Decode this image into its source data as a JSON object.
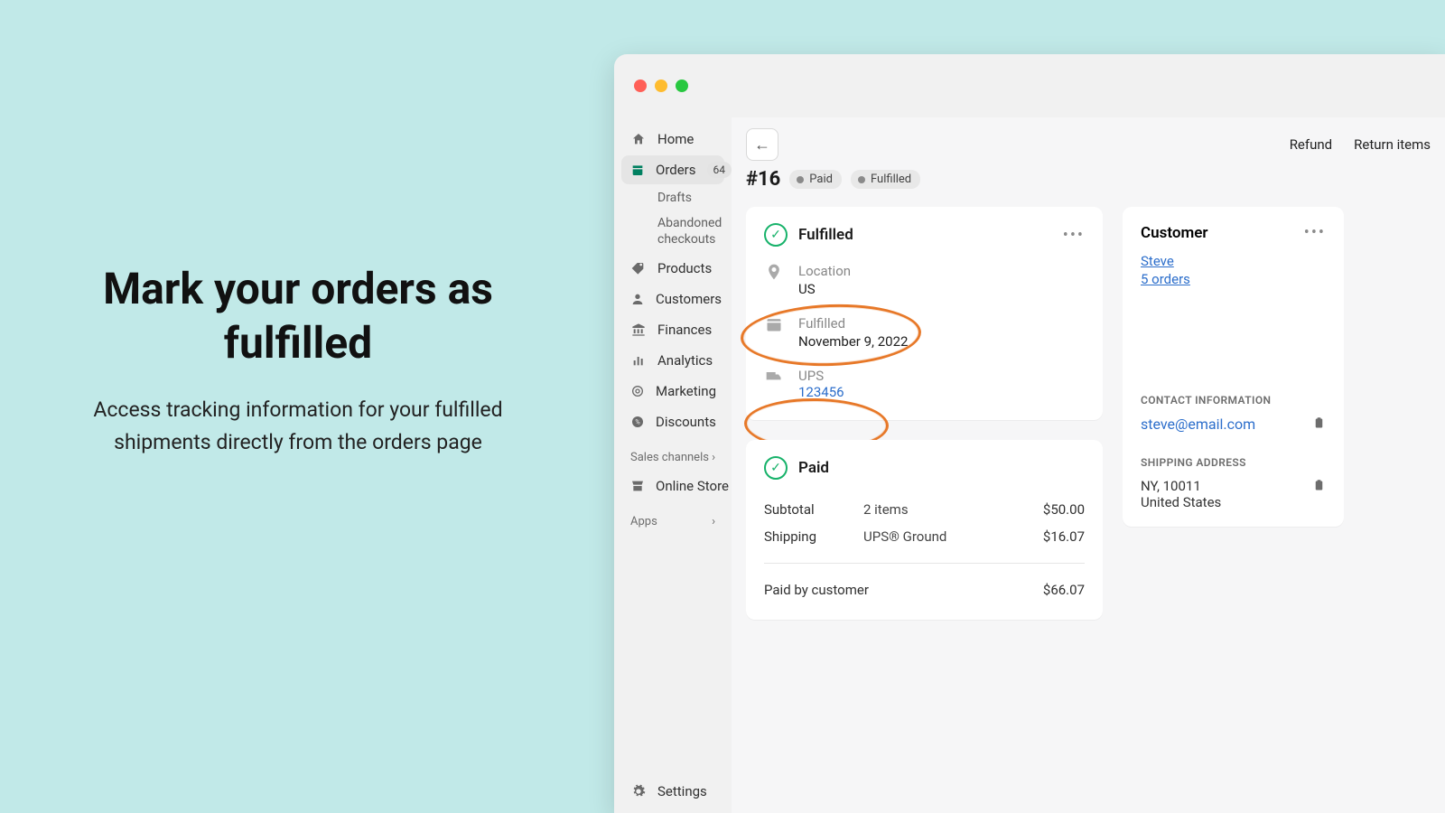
{
  "promo": {
    "headline": "Mark your orders as fulfilled",
    "sub": "Access tracking information for your fulfilled shipments directly from the orders page"
  },
  "sidebar": {
    "home": "Home",
    "orders": "Orders",
    "orders_badge": "64",
    "drafts": "Drafts",
    "abandoned": "Abandoned checkouts",
    "products": "Products",
    "customers": "Customers",
    "finances": "Finances",
    "analytics": "Analytics",
    "marketing": "Marketing",
    "discounts": "Discounts",
    "sales_channels_h": "Sales channels",
    "online_store": "Online Store",
    "apps_h": "Apps",
    "settings": "Settings"
  },
  "topbar": {
    "refund": "Refund",
    "return": "Return items"
  },
  "order": {
    "id": "#16",
    "pill_paid": "Paid",
    "pill_fulfilled": "Fulfilled"
  },
  "fulfilled_card": {
    "title": "Fulfilled",
    "location_label": "Location",
    "location_value": "US",
    "fulfilled_label": "Fulfilled",
    "fulfilled_value": "November 9, 2022",
    "carrier": "UPS",
    "tracking": "123456"
  },
  "paid_card": {
    "title": "Paid",
    "subtotal_label": "Subtotal",
    "subtotal_desc": "2 items",
    "subtotal_amount": "$50.00",
    "shipping_label": "Shipping",
    "shipping_desc": "UPS® Ground",
    "shipping_amount": "$16.07",
    "paidby_label": "Paid by customer",
    "paidby_amount": "$66.07"
  },
  "customer_card": {
    "title": "Customer",
    "name": "Steve",
    "orders": "5 orders",
    "contact_h": "CONTACT INFORMATION",
    "email": "steve@email.com",
    "shipping_h": "SHIPPING ADDRESS",
    "addr1": "NY, 10011",
    "addr2": "United States"
  }
}
